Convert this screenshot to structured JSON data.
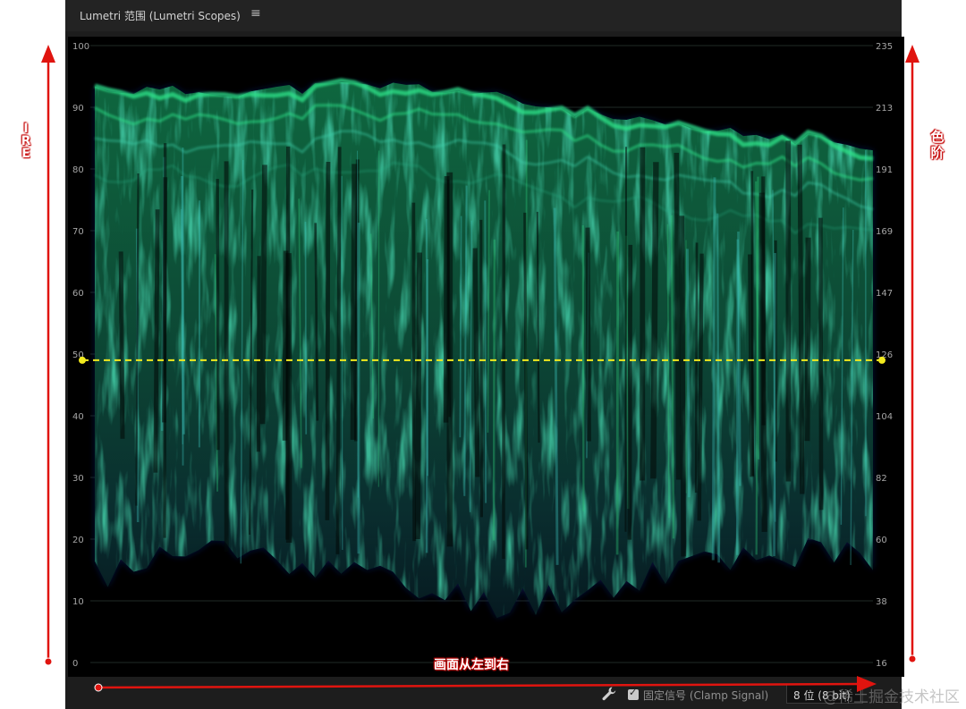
{
  "panel": {
    "title": "Lumetri 范围 (Lumetri Scopes)",
    "menu_icon": "≡"
  },
  "scope": {
    "type": "luma-waveform",
    "left_axis_ire": [
      "100",
      "90",
      "80",
      "70",
      "60",
      "50",
      "40",
      "30",
      "20",
      "10",
      "0"
    ],
    "right_axis_levels": [
      "235",
      "213",
      "191",
      "169",
      "147",
      "126",
      "104",
      "82",
      "60",
      "38",
      "16"
    ],
    "reference_line_ire": 49,
    "colors": {
      "background": "#000000",
      "trace": "#2ee58a",
      "trace_blue": "#2a4fd6",
      "reference_line": "#f2ea1e"
    }
  },
  "annotations": {
    "ire_label": "IRE",
    "level_label": "色阶",
    "left_to_right_label": "画面从左到右",
    "arrow_color": "#e0140f"
  },
  "footer": {
    "wrench_icon": "wrench-icon",
    "clamp_checked": true,
    "clamp_label": "固定信号 (Clamp Signal)",
    "bit_depth": "8 位 (8 bit)"
  },
  "watermark": "@稀土掘金技术社区"
}
